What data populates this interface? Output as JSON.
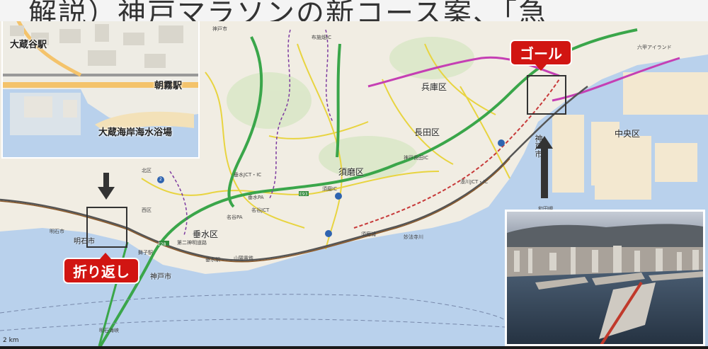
{
  "headline": "解説）神戸マラソンの新コース案、「急",
  "inset": {
    "labels": [
      "大蔵谷駅",
      "朝霧駅",
      "大蔵海岸海水浴場"
    ]
  },
  "callouts": {
    "goal": "ゴール",
    "turnaround": "折り返し"
  },
  "wards": [
    "兵庫区",
    "長田区",
    "須磨区",
    "垂水区",
    "中央区"
  ],
  "city_labels": {
    "kobe": "神戸市",
    "akashi": "明石市",
    "kobe_small": "神戸市"
  },
  "small_labels": [
    "北区",
    "神戸市",
    "西区",
    "明石市",
    "垂水JCT・IC",
    "名谷JCT",
    "名谷PA",
    "垂水PA",
    "須磨IC",
    "布施畑IC",
    "神戸長田IC",
    "湊川JCT・IC",
    "第二神明道路",
    "山陽電鉄",
    "舞子駅",
    "垂水駅",
    "須磨浦",
    "妙法寺川",
    "明石海峡",
    "和田岬",
    "六甲アイランド",
    "E28",
    "E93",
    "2"
  ],
  "scale": "2 km"
}
